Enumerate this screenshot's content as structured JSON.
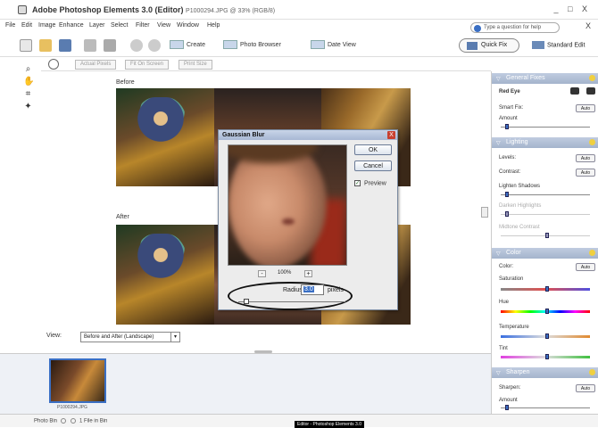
{
  "titlebar": {
    "title": "Adobe Photoshop Elements 3.0 (Editor)",
    "subtitle": "P1000294.JPG @ 33% (RGB/8)",
    "controls": "_ □ X"
  },
  "menu": {
    "items": [
      "File",
      "Edit",
      "Image",
      "Enhance",
      "Layer",
      "Select",
      "Filter",
      "View",
      "Window",
      "Help"
    ],
    "help_placeholder": "Type a question for help",
    "help_close": "X"
  },
  "toolbar": {
    "create_label": "Create",
    "photo_browser_label": "Photo Browser",
    "date_view_label": "Date View",
    "quick_fix_label": "Quick Fix",
    "standard_edit_label": "Standard Edit"
  },
  "options": {
    "actual_pixels": "Actual Pixels",
    "fit_on_screen": "Fit On Screen",
    "print_size": "Print Size"
  },
  "workspace": {
    "before_label": "Before",
    "after_label": "After",
    "view_label": "View:",
    "view_value": "Before and After (Landscape)",
    "view_arrow": "▾"
  },
  "bin": {
    "thumb_label": "P1000294.JPG"
  },
  "status": {
    "photo_bin": "Photo Bin",
    "file_in_bin": "1 File in Bin",
    "tooltip": "Editor - Photoshop Elements 3.0"
  },
  "dialog": {
    "title": "Gaussian Blur",
    "close": "X",
    "ok": "OK",
    "cancel": "Cancel",
    "preview_label": "Preview",
    "preview_checked": "✓",
    "zoom_minus": "-",
    "zoom_plus": "+",
    "zoom_value": "100%",
    "radius_label": "Radius:",
    "radius_value": "3.0",
    "radius_units": "pixels",
    "radius_fraction": 0.05
  },
  "palette": {
    "general_fixes": {
      "title": "General Fixes",
      "redeye": "Red Eye",
      "smart_fix": "Smart Fix:",
      "auto": "Auto",
      "amount": "Amount",
      "amount_fraction": 0.05
    },
    "lighting": {
      "title": "Lighting",
      "levels": "Levels:",
      "contrast": "Contrast:",
      "auto": "Auto",
      "lighten_shadows": "Lighten Shadows",
      "darken_highlights": "Darken Highlights",
      "midtone_contrast": "Midtone Contrast",
      "shadows_fraction": 0.05,
      "highlights_fraction": 0.05,
      "midtone_fraction": 0.5
    },
    "color": {
      "title": "Color",
      "color_label": "Color:",
      "auto": "Auto",
      "saturation": "Saturation",
      "hue": "Hue",
      "temperature": "Temperature",
      "tint": "Tint",
      "saturation_fraction": 0.5,
      "hue_fraction": 0.5,
      "temperature_fraction": 0.5,
      "tint_fraction": 0.5
    },
    "sharpen": {
      "title": "Sharpen",
      "sharpen_label": "Sharpen:",
      "auto": "Auto",
      "amount": "Amount",
      "amount_fraction": 0.05
    }
  },
  "colors": {
    "accent": "#3a6fc4",
    "panel_header": "#a4b4cc",
    "close_red": "#c84030"
  }
}
